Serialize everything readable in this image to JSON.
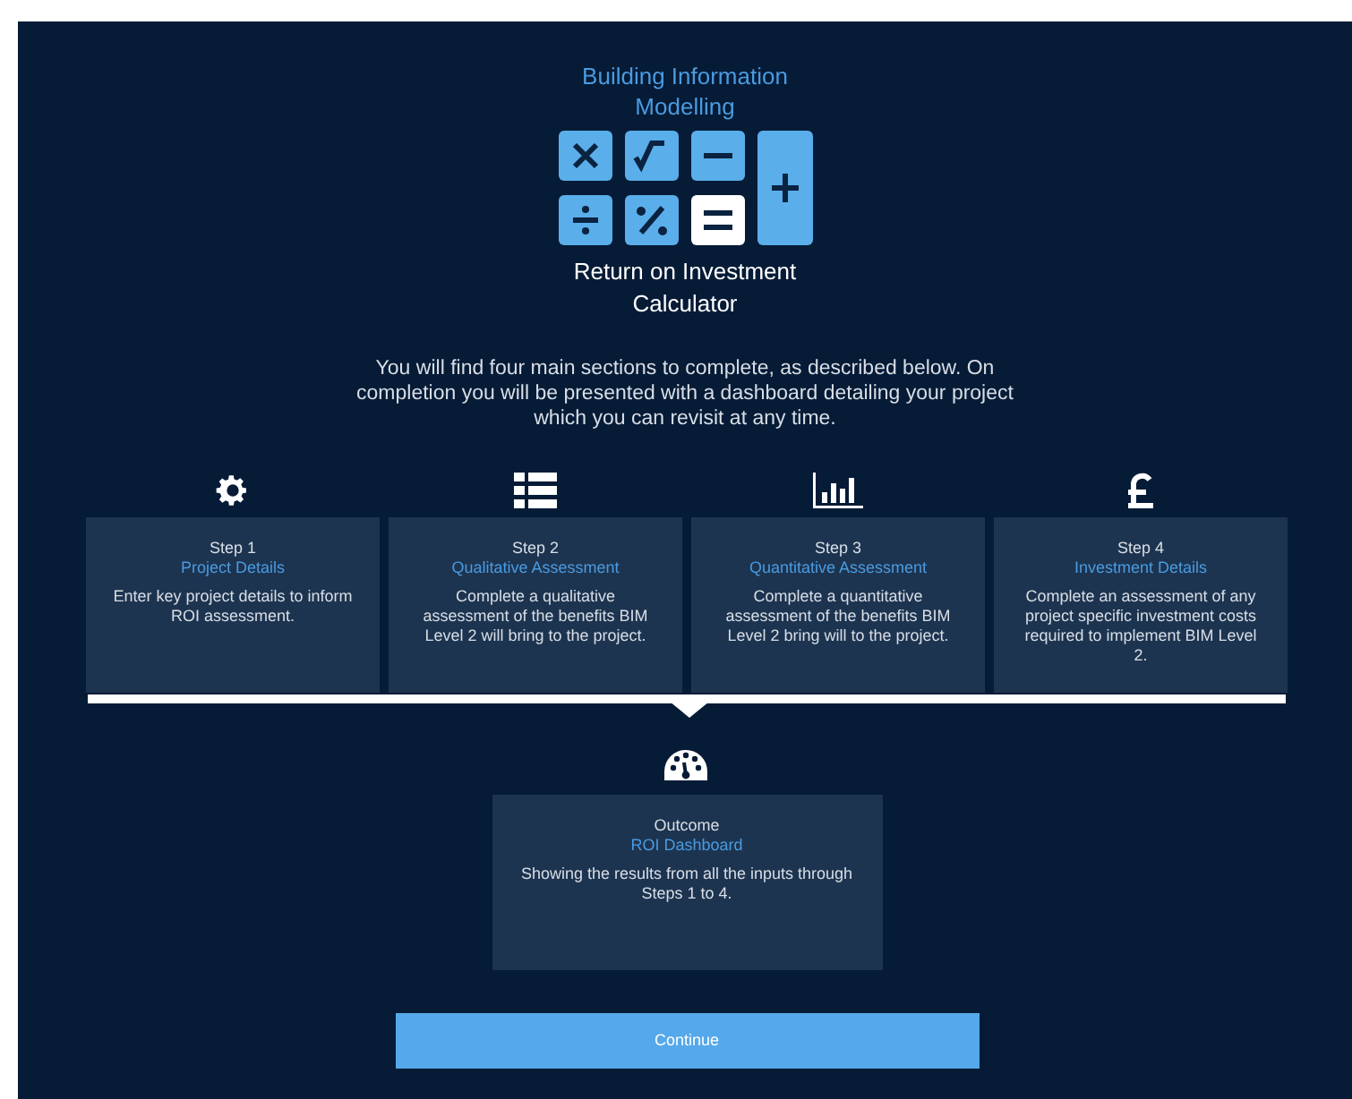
{
  "header": {
    "title": "Building Information Modelling",
    "subtitle": "Return on Investment Calculator"
  },
  "intro": "You will find four main sections to complete, as described below. On completion you will be presented with a dashboard detailing your project which you can revisit at any time.",
  "steps": [
    {
      "step": "Step 1",
      "title": "Project Details",
      "description": "Enter key project details to inform ROI assessment."
    },
    {
      "step": "Step 2",
      "title": "Qualitative Assessment",
      "description": "Complete a qualitative assessment of the benefits BIM Level 2 will bring to the project."
    },
    {
      "step": "Step 3",
      "title": "Quantitative Assessment",
      "description": "Complete a quantitative assessment of the benefits BIM Level 2 bring will to the project."
    },
    {
      "step": "Step 4",
      "title": "Investment Details",
      "description": "Complete an assessment of any project specific investment costs required to implement BIM Level 2."
    }
  ],
  "outcome": {
    "step": "Outcome",
    "title": "ROI Dashboard",
    "description": "Showing the results from all the inputs through Steps 1 to 4."
  },
  "continue_button": "Continue"
}
